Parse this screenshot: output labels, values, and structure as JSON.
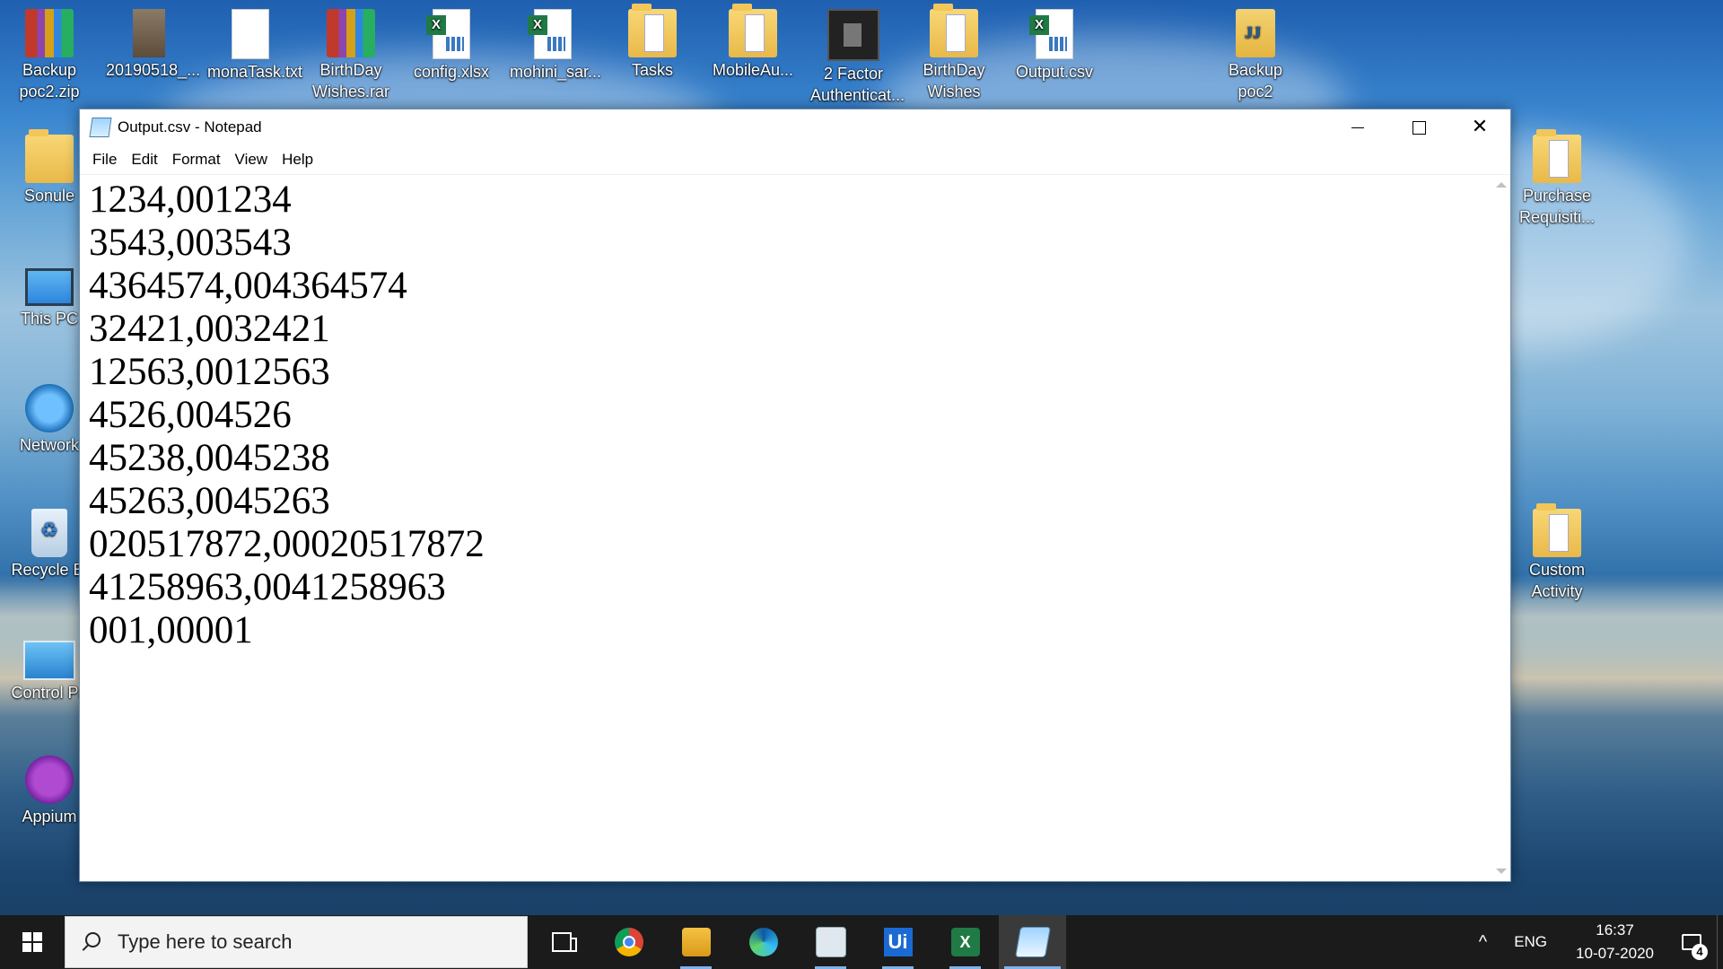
{
  "desktop": {
    "icons_top": [
      {
        "label": "Backup poc2.zip",
        "icon": "winrar-archive-icon"
      },
      {
        "label": "20190518_...",
        "icon": "photo-icon"
      },
      {
        "label": "monaTask.txt",
        "icon": "text-file-icon"
      },
      {
        "label": "BirthDay Wishes.rar",
        "icon": "winrar-archive-icon"
      },
      {
        "label": "config.xlsx",
        "icon": "excel-file-icon"
      },
      {
        "label": "mohini_sar...",
        "icon": "excel-file-icon"
      },
      {
        "label": "Tasks",
        "icon": "folder-icon"
      },
      {
        "label": "MobileAu...",
        "icon": "folder-icon"
      },
      {
        "label": "2 Factor Authenticat...",
        "icon": "video-file-icon"
      },
      {
        "label": "BirthDay Wishes",
        "icon": "folder-icon"
      },
      {
        "label": "Output.csv",
        "icon": "excel-csv-icon"
      },
      {
        "label": "Backup poc2",
        "icon": "jar-file-icon"
      }
    ],
    "icons_left": [
      {
        "label": "Sonule",
        "icon": "user-folder-icon"
      },
      {
        "label": "This PC",
        "icon": "this-pc-icon"
      },
      {
        "label": "Network",
        "icon": "network-icon"
      },
      {
        "label": "Recycle Bi",
        "icon": "recycle-bin-icon"
      },
      {
        "label": "Control Pa",
        "icon": "control-panel-icon"
      },
      {
        "label": "Appium",
        "icon": "appium-icon"
      }
    ],
    "icons_right": [
      {
        "label": "Purchase Requisiti...",
        "icon": "folder-icon"
      },
      {
        "label": "Custom Activity",
        "icon": "folder-icon"
      }
    ]
  },
  "notepad": {
    "title": "Output.csv - Notepad",
    "menu": [
      "File",
      "Edit",
      "Format",
      "View",
      "Help"
    ],
    "lines": [
      "1234,001234",
      "3543,003543",
      "4364574,004364574",
      "32421,0032421",
      "12563,0012563",
      "4526,004526",
      "45238,0045238",
      "45263,0045263",
      "020517872,00020517872",
      "41258963,0041258963",
      "001,00001"
    ]
  },
  "taskbar": {
    "search_placeholder": "Type here to search",
    "apps": [
      "task-view-icon",
      "chrome-icon",
      "file-explorer-icon",
      "edge-icon",
      "window-icon",
      "uipath-icon",
      "excel-icon",
      "notepad-icon"
    ],
    "uipath_label": "Ui",
    "excel_label": "X",
    "language": "ENG",
    "time": "16:37",
    "date": "10-07-2020",
    "notification_count": "4",
    "chevron": "^"
  }
}
